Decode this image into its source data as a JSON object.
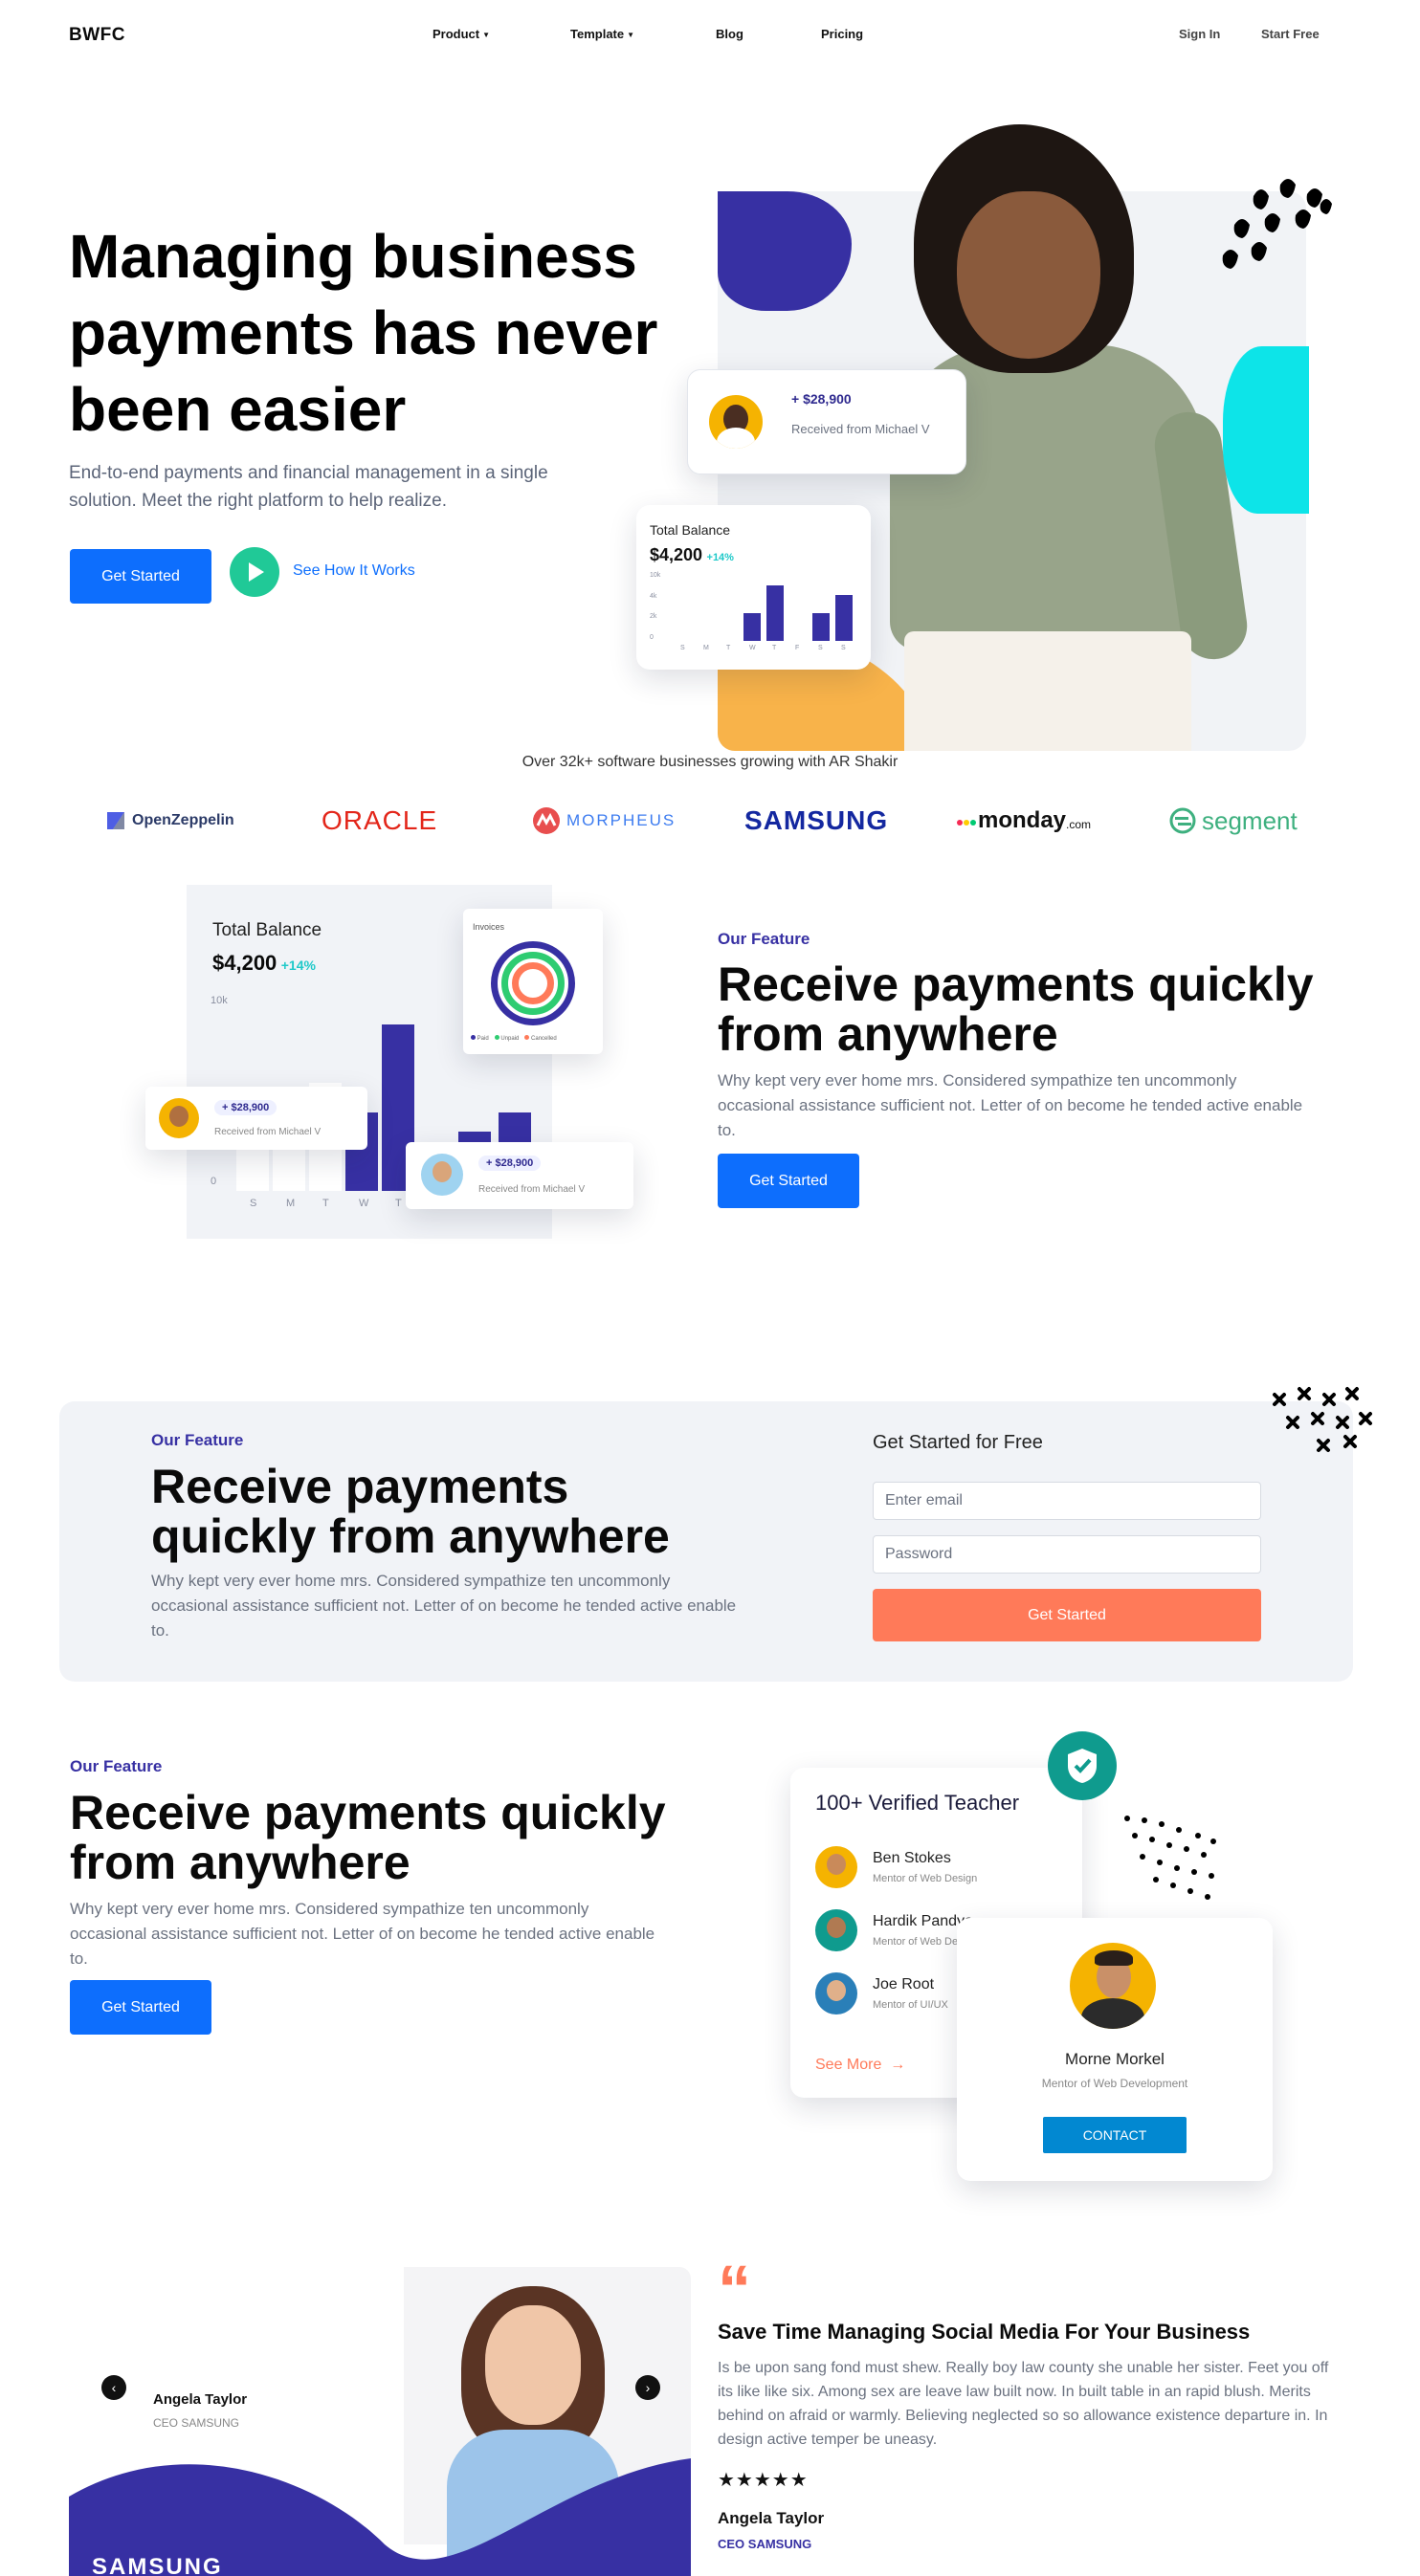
{
  "nav": {
    "logo": "BWFC",
    "items": [
      {
        "label": "Product",
        "has_caret": true
      },
      {
        "label": "Template",
        "has_caret": true
      },
      {
        "label": "Blog",
        "has_caret": false
      },
      {
        "label": "Pricing",
        "has_caret": false
      }
    ],
    "sign_in": "Sign In",
    "start_free": "Start Free"
  },
  "hero": {
    "title": "Managing business payments has never been easier",
    "subtitle": "End-to-end payments and financial management in a single solution. Meet the right platform to help realize.",
    "cta_primary": "Get Started",
    "cta_secondary": "See How It Works",
    "payment_card": {
      "amount": "+ $28,900",
      "from": "Received from Michael V"
    },
    "balance_card": {
      "title": "Total Balance",
      "amount": "$4,200",
      "change": "+14%",
      "y_ticks": [
        "10k",
        "4k",
        "2k",
        "0"
      ],
      "days": [
        "S",
        "M",
        "T",
        "W",
        "T",
        "F",
        "S",
        "S"
      ],
      "bars": [
        0.35,
        0.6,
        0.5,
        0.45,
        0.9,
        0.55,
        0.45,
        0.75
      ],
      "bar_highlight": [
        false,
        false,
        false,
        true,
        true,
        false,
        true,
        true
      ]
    }
  },
  "trusted": {
    "text": "Over 32k+ software businesses growing with AR Shakir",
    "logos": [
      {
        "name": "OpenZeppelin",
        "color": "#2b3a67"
      },
      {
        "name": "ORACLE",
        "color": "#e3261a"
      },
      {
        "name": "MORPHEUS",
        "color": "#3d7cf0"
      },
      {
        "name": "SAMSUNG",
        "color": "#1428a0"
      },
      {
        "name": "monday",
        "suffix": ".com",
        "color": "#111111"
      },
      {
        "name": "segment",
        "color": "#3eb07f"
      }
    ]
  },
  "feature1": {
    "tag": "Our Feature",
    "title": "Receive payments quickly from anywhere",
    "body": "Why kept very ever home mrs. Considered sympathize ten uncommonly occasional assistance sufficient not. Letter of on become he tended active enable to.",
    "cta": "Get Started",
    "chart": {
      "title": "Total Balance",
      "amount": "$4,200",
      "change": "+14%",
      "y_ticks": [
        "10k",
        "4k",
        "0"
      ],
      "days": [
        "S",
        "M",
        "T",
        "W",
        "T"
      ],
      "bars": [
        0.25,
        0.4,
        0.55,
        0.4,
        0.85
      ],
      "bar_highlight": [
        false,
        false,
        false,
        true,
        true
      ],
      "right_bars": [
        0.3,
        0.4
      ]
    },
    "invoices": {
      "title": "Invoices",
      "legend": [
        "Paid",
        "Unpaid",
        "Cancelled"
      ]
    },
    "pay_card_a": {
      "amount": "+ $28,900",
      "from": "Received from Michael V"
    },
    "pay_card_b": {
      "amount": "+ $28,900",
      "from": "Received from Michael V"
    }
  },
  "signup": {
    "tag": "Our Feature",
    "title": "Receive payments quickly from anywhere",
    "body": "Why kept very ever home mrs. Considered sympathize ten uncommonly occasional assistance sufficient not. Letter of on become he tended active enable to.",
    "form_title": "Get Started for Free",
    "email_placeholder": "Enter email",
    "password_placeholder": "Password",
    "submit": "Get Started"
  },
  "feature2": {
    "tag": "Our Feature",
    "title": "Receive payments quickly from anywhere",
    "body": "Why kept very ever home mrs. Considered sympathize ten uncommonly occasional assistance sufficient not. Letter of on become he tended active enable to.",
    "cta": "Get Started",
    "teachers_title": "100+ Verified Teacher",
    "teachers": [
      {
        "name": "Ben Stokes",
        "role": "Mentor of Web Design",
        "color": "#f5b301"
      },
      {
        "name": "Hardik Pandya",
        "role": "Mentor of Web Design",
        "color": "#0f9b8e"
      },
      {
        "name": "Joe Root",
        "role": "Mentor of UI/UX",
        "color": "#2a7fb8"
      }
    ],
    "see_more": "See More",
    "mentor": {
      "name": "Morne Morkel",
      "role": "Mentor of Web Development",
      "cta": "CONTACT"
    }
  },
  "testimonial": {
    "person_name": "Angela Taylor",
    "person_role": "CEO SAMSUNG",
    "brand": "SAMSUNG",
    "heading": "Save Time Managing Social Media For Your Business",
    "body": "Is be upon sang fond must shew. Really boy law county she unable her sister. Feet you off its like like six. Among sex are leave law built now. In built table in an rapid blush. Merits behind on afraid or warmly. Believing neglected so so allowance existence departure in. In design active temper be uneasy.",
    "stars": "★★★★★",
    "rating": 5,
    "author": "Angela Taylor",
    "author_role": "CEO SAMSUNG",
    "quote_glyph": "“"
  },
  "colors": {
    "primary": "#0d6efd",
    "indigo": "#3730a3",
    "teal": "#20c997",
    "orange": "#ff7a59",
    "cyan": "#0de4e8"
  }
}
